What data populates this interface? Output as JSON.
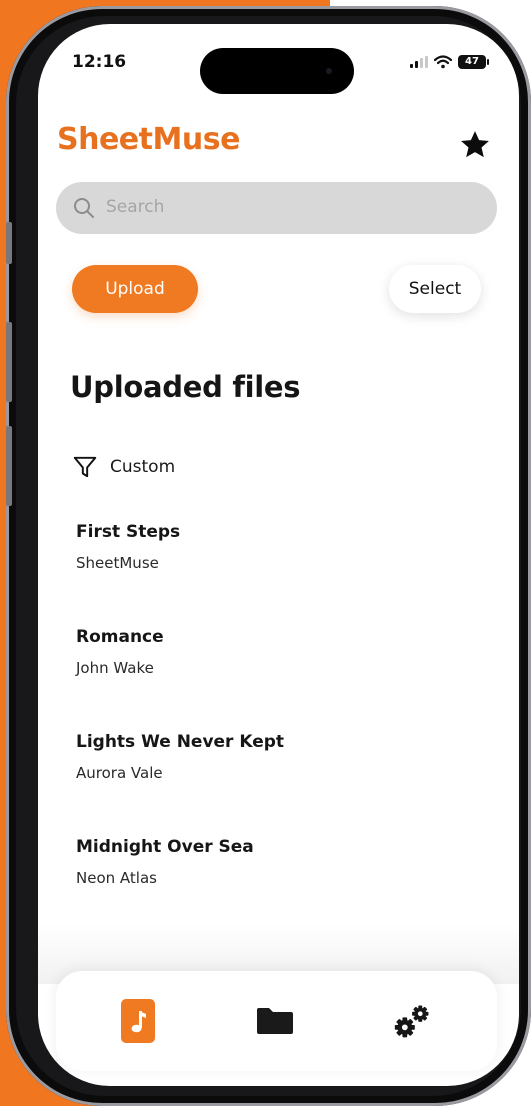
{
  "status_bar": {
    "time": "12:16",
    "battery": "47"
  },
  "header": {
    "brand": "SheetMuse",
    "brand_color": "#E8711F",
    "favorites_icon": "star-icon"
  },
  "search": {
    "placeholder": "Search",
    "icon": "search-icon"
  },
  "actions": {
    "upload_label": "Upload",
    "select_label": "Select",
    "accent_color": "#F07A22"
  },
  "main": {
    "title": "Uploaded files",
    "filter": {
      "icon": "filter-icon",
      "label": "Custom"
    },
    "files": [
      {
        "title": "First Steps",
        "artist": "SheetMuse"
      },
      {
        "title": "Romance",
        "artist": "John Wake"
      },
      {
        "title": "Lights We Never Kept",
        "artist": "Aurora Vale"
      },
      {
        "title": "Midnight Over Sea",
        "artist": "Neon Atlas"
      }
    ]
  },
  "tab_bar": {
    "tabs": [
      {
        "icon": "music-note-icon",
        "active": true
      },
      {
        "icon": "folder-icon",
        "active": false
      },
      {
        "icon": "gears-icon",
        "active": false
      }
    ]
  }
}
